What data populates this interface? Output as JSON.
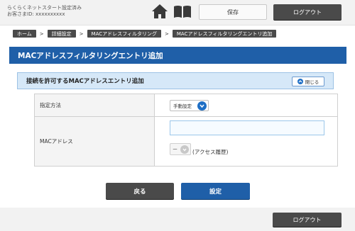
{
  "header": {
    "status_line1": "らくらくネットスタート設定済み",
    "status_line2": "お客さまID: xxxxxxxxxx",
    "home_icon": "home-icon",
    "manual_icon": "book-icon",
    "save_label": "保存",
    "logout_label": "ログアウト"
  },
  "breadcrumb": {
    "items": [
      "ホーム",
      "詳細設定",
      "MACアドレスフィルタリング",
      "MACアドレスフィルタリングエントリ追加"
    ],
    "separator": ">"
  },
  "page_title": "MACアドレスフィルタリングエントリ追加",
  "section": {
    "title": "接続を許可するMACアドレスエントリ追加",
    "close_label": "閉じる",
    "fields": {
      "method_label": "指定方法",
      "method_value": "手動設定",
      "mac_label": "MACアドレス",
      "mac_value": "",
      "history_value": "ー",
      "history_label": "(アクセス履歴)"
    }
  },
  "actions": {
    "back_label": "戻る",
    "set_label": "設定"
  },
  "footer": {
    "logout_label": "ログアウト"
  },
  "colors": {
    "brand_blue": "#1f5fa8",
    "dark_button": "#4a4a4a",
    "section_bg": "#d6e8f8"
  }
}
